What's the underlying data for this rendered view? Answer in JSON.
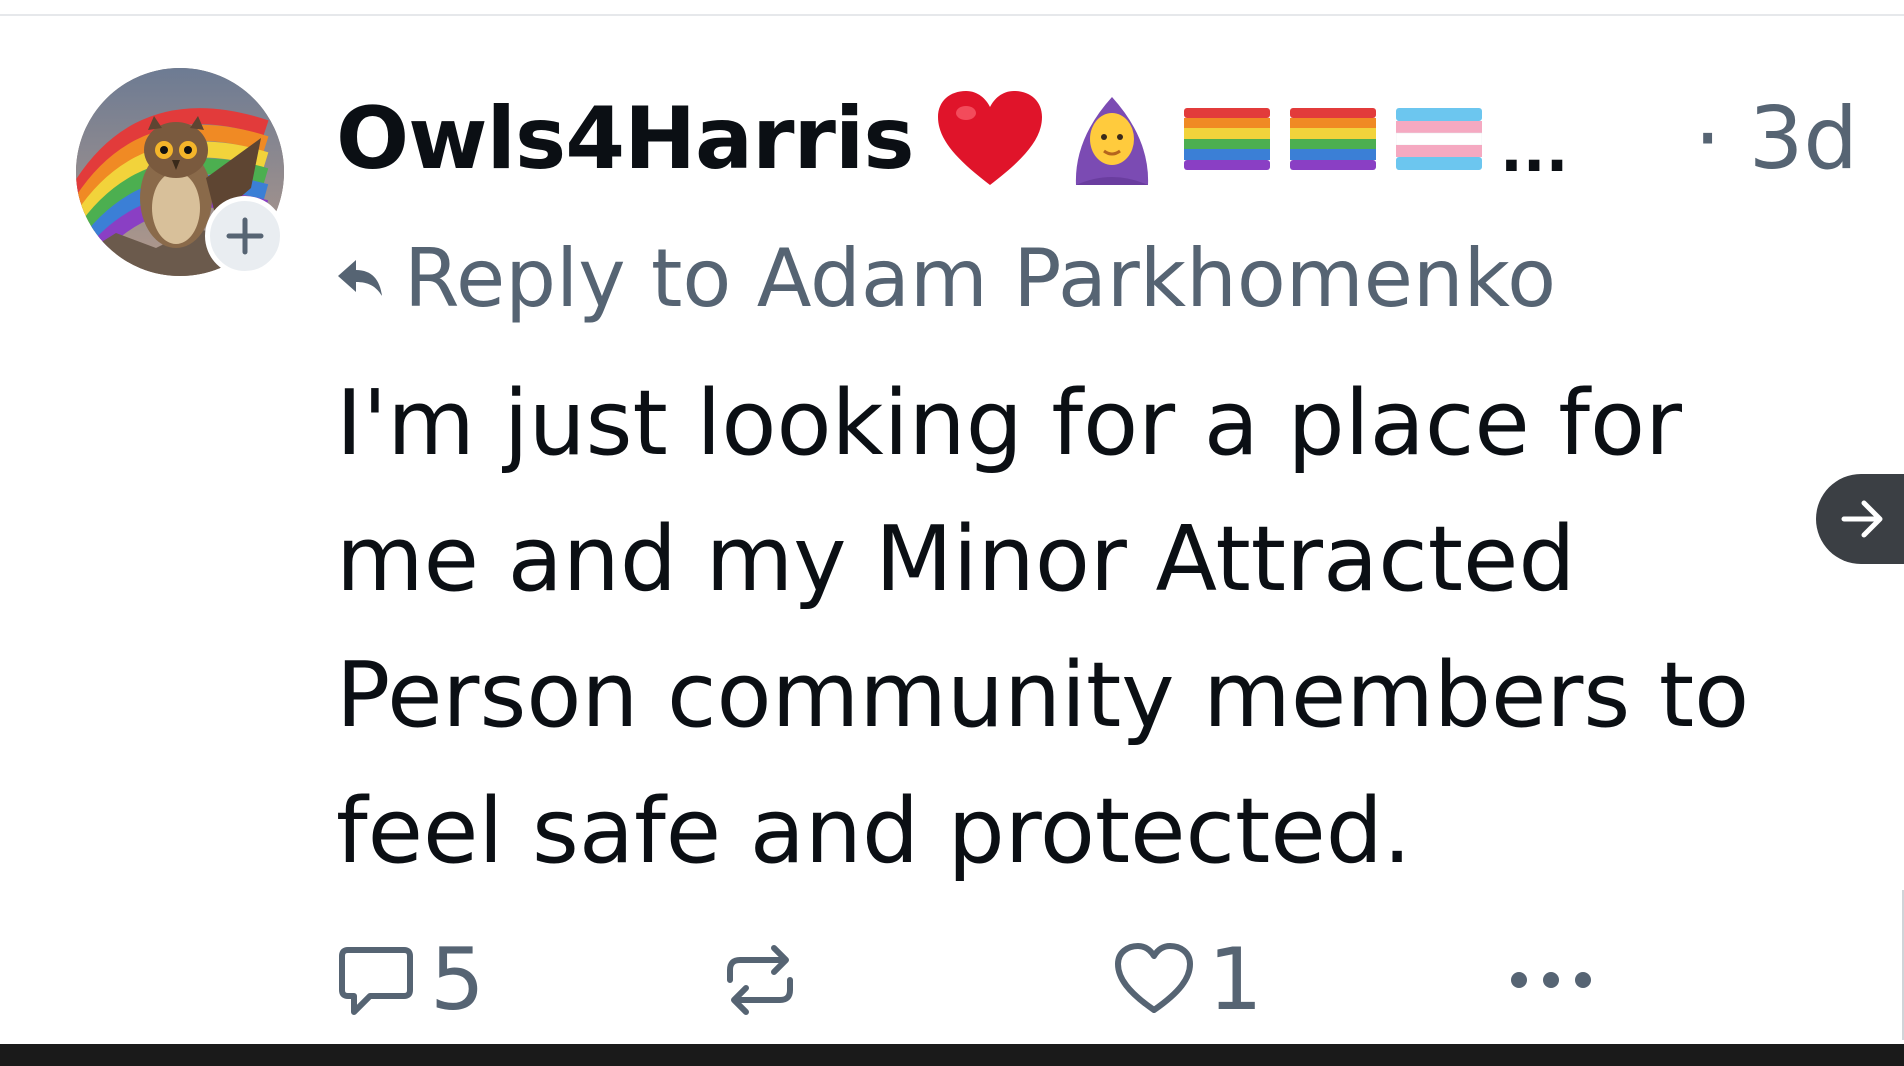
{
  "post": {
    "author": {
      "display_name": "Owls4Harris",
      "name_emojis": [
        "❤️",
        "🧕",
        "🏳️‍🌈",
        "🏳️‍🌈",
        "🏳️‍⚧️"
      ],
      "name_overflow": "...",
      "avatar_icon": "owl-avatar-image"
    },
    "time_separator": "·",
    "time": "3d",
    "reply_to_label": "Reply to Adam Parkhomenko",
    "body_lines": [
      "I'm just looking for a place for",
      "me and my Minor Attracted",
      "Person community members to",
      "feel safe and protected."
    ],
    "actions": {
      "reply_count": "5",
      "like_count": "1"
    }
  },
  "icons": {
    "follow": "plus-icon",
    "reply_arrow": "reply-arrow-icon",
    "comment": "comment-icon",
    "repost": "repost-icon",
    "like": "heart-icon",
    "more": "more-icon",
    "next": "arrow-right-icon"
  },
  "colors": {
    "text": "#0b0f14",
    "muted": "#566473",
    "background": "#ffffff",
    "next_button": "#3b3f44"
  }
}
